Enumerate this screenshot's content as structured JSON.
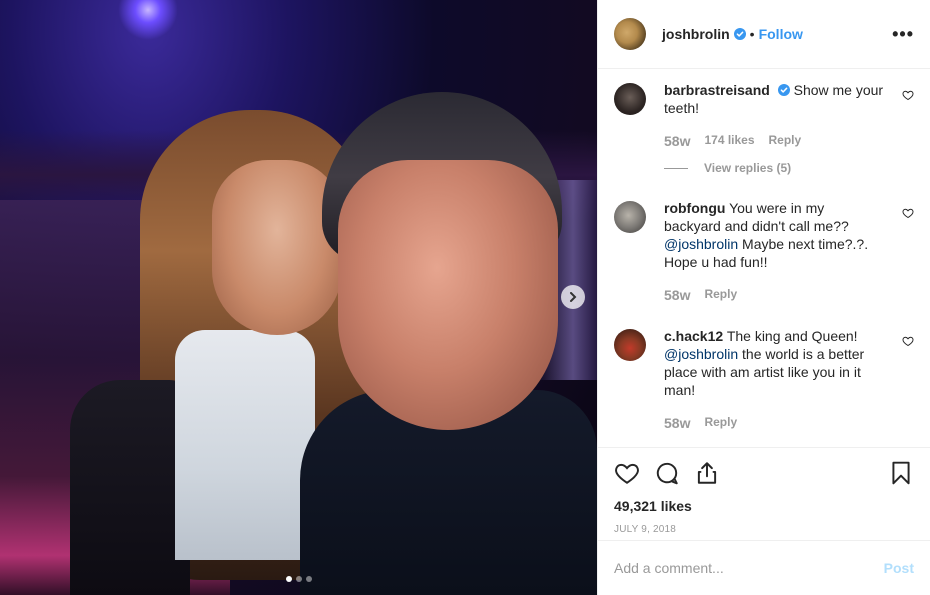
{
  "post": {
    "author": "joshbrolin",
    "follow_label": "Follow",
    "bullet": "•",
    "more_label": "•••",
    "likes": "49,321 likes",
    "date": "JULY 9, 2018",
    "carousel_dots": 3
  },
  "comments": [
    {
      "user": "barbrastreisand",
      "verified": true,
      "text_parts": [
        "Show me your teeth!"
      ],
      "age": "58w",
      "likes": "174 likes",
      "reply": "Reply",
      "view_replies": "View replies (5)"
    },
    {
      "user": "robfongu",
      "verified": false,
      "text_start": "You were in my backyard and didn't call me??",
      "mention": "@joshbrolin",
      "text_end": "Maybe next time?.?. Hope u had fun!!",
      "age": "58w",
      "reply": "Reply"
    },
    {
      "user": "c.hack12",
      "verified": false,
      "text_start": "The king and Queen!",
      "mention": "@joshbrolin",
      "text_end": "the world is a better place with am artist like you in it man!",
      "age": "58w",
      "reply": "Reply"
    }
  ],
  "composer": {
    "placeholder": "Add a comment...",
    "post_label": "Post"
  },
  "colors": {
    "link_blue": "#3897f0",
    "verified_blue": "#3897f0",
    "muted": "#999999",
    "text": "#262626"
  },
  "icons": [
    "verified-badge-icon",
    "heart-icon",
    "comment-icon",
    "share-icon",
    "bookmark-icon",
    "chevron-right-icon"
  ]
}
